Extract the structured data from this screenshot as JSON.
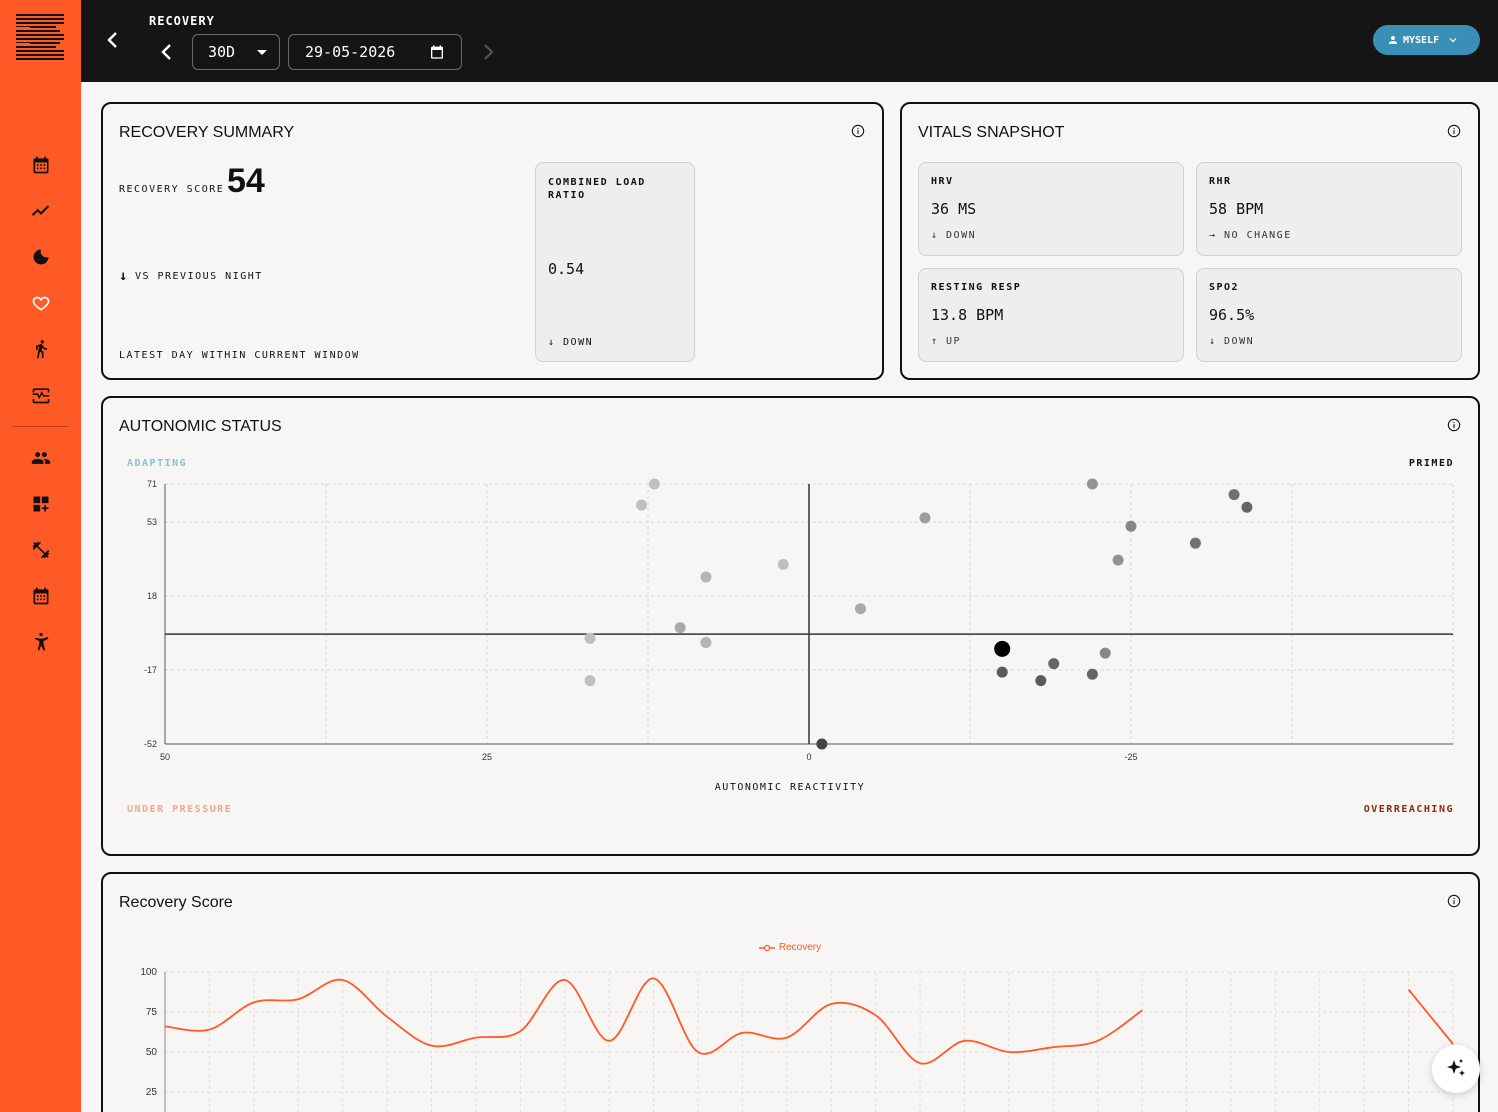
{
  "header": {
    "title": "RECOVERY",
    "range": "30D",
    "date": "29-05-2026",
    "user_label": "MYSELF"
  },
  "sidebar": {
    "items": [
      {
        "icon": "calendar-icon"
      },
      {
        "icon": "trend-icon"
      },
      {
        "icon": "moon-icon"
      },
      {
        "icon": "heart-icon"
      },
      {
        "icon": "run-icon"
      },
      {
        "icon": "monitor-heart-icon"
      },
      {
        "icon": "people-icon"
      },
      {
        "icon": "dashboard-add-icon"
      },
      {
        "icon": "dumbbell-icon"
      },
      {
        "icon": "calendar-alt-icon"
      },
      {
        "icon": "martial-arts-icon"
      }
    ]
  },
  "recovery_summary": {
    "title": "RECOVERY SUMMARY",
    "score_label": "RECOVERY SCORE",
    "score_value": "54",
    "prev_arrow": "↓",
    "prev_label": "VS PREVIOUS NIGHT",
    "window_label": "LATEST DAY WITHIN CURRENT WINDOW",
    "load_label": "COMBINED LOAD RATIO",
    "load_value": "0.54",
    "load_trend": "↓ DOWN"
  },
  "vitals": {
    "title": "VITALS SNAPSHOT",
    "items": [
      {
        "label": "HRV",
        "value": "36 MS",
        "trend": "↓ DOWN"
      },
      {
        "label": "RHR",
        "value": "58 BPM",
        "trend": "→ NO CHANGE"
      },
      {
        "label": "RESTING RESP",
        "value": "13.8 BPM",
        "trend": "↑ UP"
      },
      {
        "label": "SPO2",
        "value": "96.5%",
        "trend": "↓ DOWN"
      }
    ]
  },
  "autonomic": {
    "title": "AUTONOMIC STATUS",
    "quadrants": {
      "top_left": "ADAPTING",
      "top_right": "PRIMED",
      "bottom_left": "UNDER PRESSURE",
      "bottom_right": "OVERREACHING"
    },
    "colors": {
      "adapting": "#8cbfd8",
      "primed": "#111111",
      "under_pressure": "#f4a78f",
      "overreaching": "#8a2a12"
    }
  },
  "chart_data": [
    {
      "type": "scatter",
      "title": "AUTONOMIC STATUS",
      "xlabel": "AUTONOMIC REACTIVITY",
      "ylabel": "",
      "xlim": [
        50,
        -50
      ],
      "ylim": [
        -52,
        71
      ],
      "x_ticks": [
        "50",
        "25",
        "0",
        "-25"
      ],
      "y_ticks": [
        "71",
        "53",
        "18",
        "-17",
        "-52"
      ],
      "points": [
        {
          "x": 12,
          "y": 71,
          "shade": 0.15
        },
        {
          "x": 13,
          "y": 61,
          "shade": 0.15
        },
        {
          "x": 8,
          "y": 27,
          "shade": 0.2
        },
        {
          "x": 2,
          "y": 33,
          "shade": 0.15
        },
        {
          "x": 10,
          "y": 3,
          "shade": 0.25
        },
        {
          "x": 8,
          "y": -4,
          "shade": 0.2
        },
        {
          "x": 17,
          "y": -2,
          "shade": 0.15
        },
        {
          "x": 17,
          "y": -22,
          "shade": 0.15
        },
        {
          "x": -4,
          "y": 12,
          "shade": 0.25
        },
        {
          "x": -9,
          "y": 55,
          "shade": 0.3
        },
        {
          "x": -22,
          "y": 71,
          "shade": 0.35
        },
        {
          "x": -25,
          "y": 51,
          "shade": 0.4
        },
        {
          "x": -24,
          "y": 35,
          "shade": 0.35
        },
        {
          "x": -30,
          "y": 43,
          "shade": 0.5
        },
        {
          "x": -33,
          "y": 66,
          "shade": 0.5
        },
        {
          "x": -34,
          "y": 60,
          "shade": 0.55
        },
        {
          "x": -15,
          "y": -7,
          "shade": 1.0,
          "highlight": true
        },
        {
          "x": -15,
          "y": -18,
          "shade": 0.6
        },
        {
          "x": -18,
          "y": -22,
          "shade": 0.6
        },
        {
          "x": -19,
          "y": -14,
          "shade": 0.55
        },
        {
          "x": -22,
          "y": -19,
          "shade": 0.55
        },
        {
          "x": -23,
          "y": -9,
          "shade": 0.4
        },
        {
          "x": -1,
          "y": -52,
          "shade": 0.7
        }
      ]
    },
    {
      "type": "line",
      "title": "Recovery Score",
      "series": [
        {
          "name": "Recovery",
          "color": "#ff5a26"
        }
      ],
      "ylim": [
        25,
        100
      ],
      "y_ticks": [
        "100",
        "75",
        "50",
        "25"
      ],
      "x": [
        0,
        1,
        2,
        3,
        4,
        5,
        6,
        7,
        8,
        9,
        10,
        11,
        12,
        13,
        14,
        15,
        16,
        17,
        18,
        19,
        20,
        21,
        22,
        23,
        24,
        25,
        26,
        27,
        28,
        29
      ],
      "values": [
        66,
        64,
        81,
        83,
        95,
        72,
        54,
        59,
        63,
        95,
        57,
        96,
        50,
        62,
        59,
        80,
        73,
        43,
        57,
        50,
        53,
        57,
        76,
        null,
        null,
        null,
        null,
        null,
        89,
        55
      ]
    }
  ],
  "recovery_chart": {
    "title": "Recovery Score",
    "legend_label": "Recovery"
  }
}
